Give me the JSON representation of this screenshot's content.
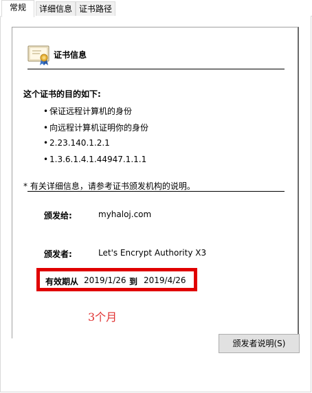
{
  "tabs": [
    {
      "label": "常规",
      "active": true
    },
    {
      "label": "详细信息",
      "active": false
    },
    {
      "label": "证书路径",
      "active": false
    }
  ],
  "certificate": {
    "title": "证书信息",
    "icon": "certificate-icon",
    "purpose_heading": "这个证书的目的如下:",
    "purposes": [
      "保证远程计算机的身份",
      "向远程计算机证明你的身份",
      "2.23.140.1.2.1",
      "1.3.6.1.4.1.44947.1.1.1"
    ],
    "note": "* 有关详细信息，请参考证书颁发机构的说明。",
    "issued_to_label": "颁发给:",
    "issued_to_value": "myhaloj.com",
    "issued_by_label": "颁发者:",
    "issued_by_value": "Let's Encrypt Authority X3",
    "valid_from_label": "有效期从",
    "valid_from_value": "2019/1/26",
    "valid_to_label": "到",
    "valid_to_value": "2019/4/26"
  },
  "annotation": {
    "text": "3个月",
    "color": "#e03030"
  },
  "buttons": {
    "issuer_statement": "颁发者说明(S)"
  },
  "colors": {
    "highlight_border": "#e00000",
    "button_bg": "#e1e1e1"
  }
}
